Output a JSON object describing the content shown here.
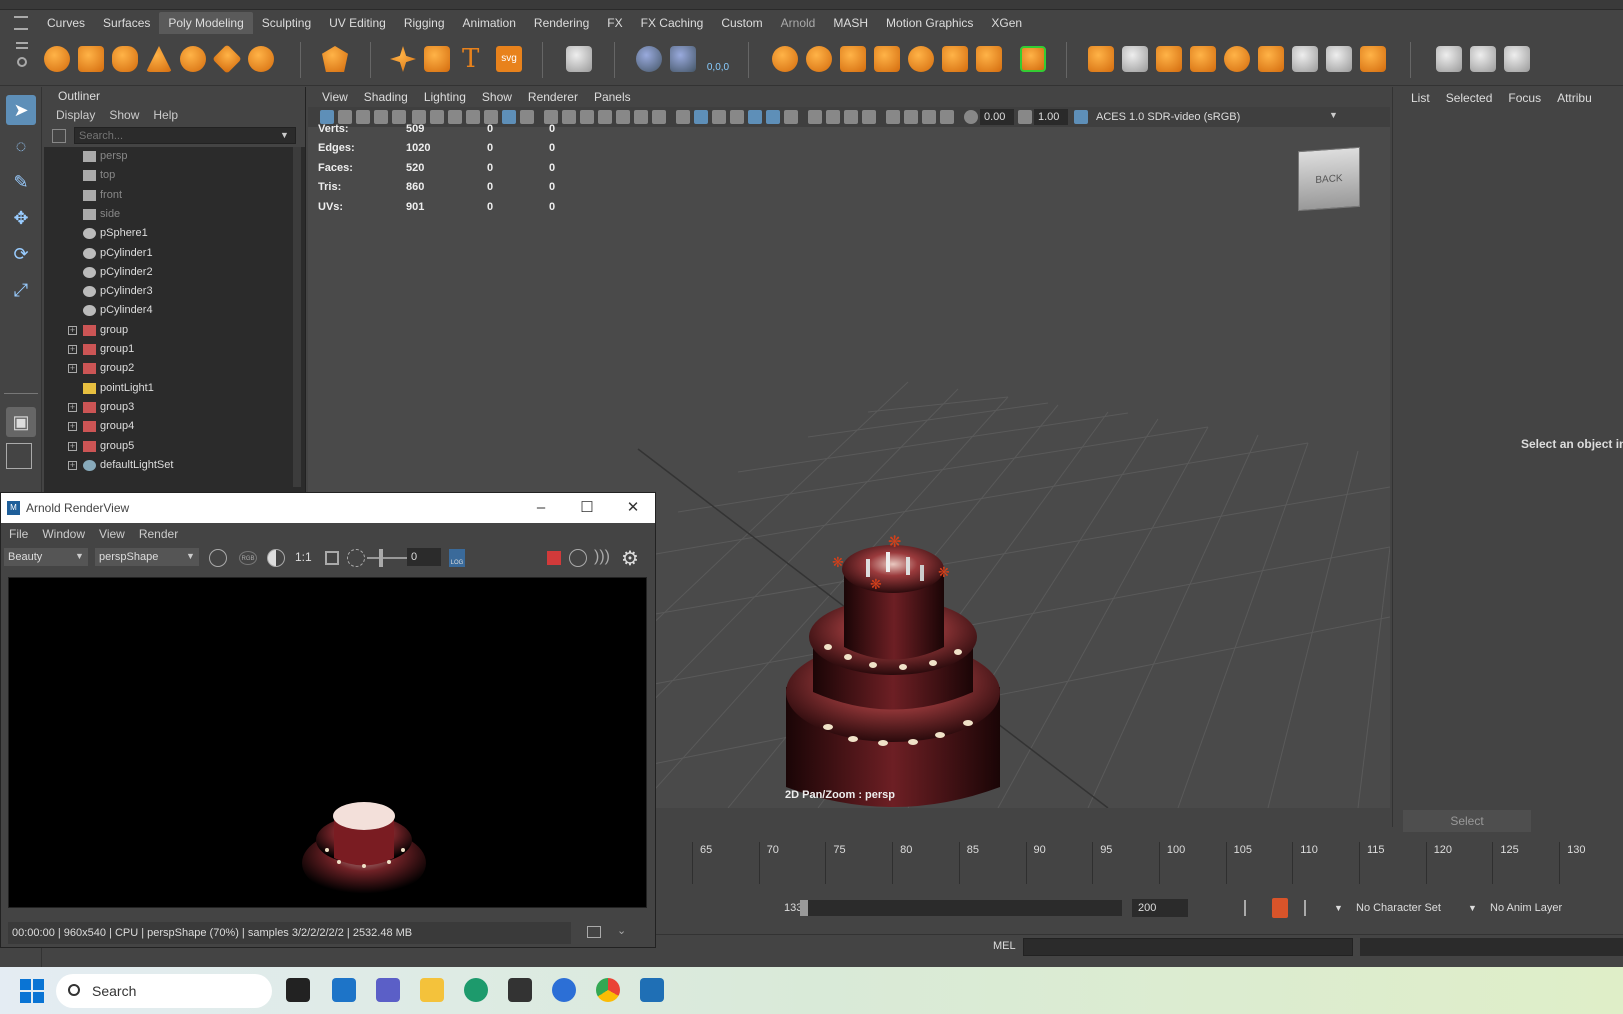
{
  "shelf": {
    "tabs": [
      "Curves",
      "Surfaces",
      "Poly Modeling",
      "Sculpting",
      "UV Editing",
      "Rigging",
      "Animation",
      "Rendering",
      "FX",
      "FX Caching",
      "Custom",
      "Arnold",
      "MASH",
      "Motion Graphics",
      "XGen"
    ],
    "active_tab": "Poly Modeling"
  },
  "outliner": {
    "title": "Outliner",
    "menu": [
      "Display",
      "Show",
      "Help"
    ],
    "search_placeholder": "Search...",
    "items": [
      {
        "label": "persp",
        "type": "camera",
        "dim": true
      },
      {
        "label": "top",
        "type": "camera",
        "dim": true
      },
      {
        "label": "front",
        "type": "camera",
        "dim": true
      },
      {
        "label": "side",
        "type": "camera",
        "dim": true
      },
      {
        "label": "pSphere1",
        "type": "mesh"
      },
      {
        "label": "pCylinder1",
        "type": "mesh"
      },
      {
        "label": "pCylinder2",
        "type": "mesh"
      },
      {
        "label": "pCylinder3",
        "type": "mesh"
      },
      {
        "label": "pCylinder4",
        "type": "mesh"
      },
      {
        "label": "group",
        "type": "group",
        "expandable": true
      },
      {
        "label": "group1",
        "type": "group",
        "expandable": true
      },
      {
        "label": "group2",
        "type": "group",
        "expandable": true
      },
      {
        "label": "pointLight1",
        "type": "light"
      },
      {
        "label": "group3",
        "type": "group",
        "expandable": true
      },
      {
        "label": "group4",
        "type": "group",
        "expandable": true
      },
      {
        "label": "group5",
        "type": "group",
        "expandable": true
      },
      {
        "label": "defaultLightSet",
        "type": "set",
        "expandable": true
      }
    ]
  },
  "viewport": {
    "menu": [
      "View",
      "Shading",
      "Lighting",
      "Show",
      "Renderer",
      "Panels"
    ],
    "exposure": "0.00",
    "gamma": "1.00",
    "color_space": "ACES 1.0 SDR-video (sRGB)",
    "hud": [
      {
        "label": "Verts:",
        "v1": "509",
        "v2": "0",
        "v3": "0"
      },
      {
        "label": "Edges:",
        "v1": "1020",
        "v2": "0",
        "v3": "0"
      },
      {
        "label": "Faces:",
        "v1": "520",
        "v2": "0",
        "v3": "0"
      },
      {
        "label": "Tris:",
        "v1": "860",
        "v2": "0",
        "v3": "0"
      },
      {
        "label": "UVs:",
        "v1": "901",
        "v2": "0",
        "v3": "0"
      }
    ],
    "viewcube_label": "BACK",
    "caption": "2D Pan/Zoom : persp"
  },
  "right_panel": {
    "tabs": [
      "List",
      "Selected",
      "Focus",
      "Attribu"
    ],
    "message": "Select an object in t",
    "select_button": "Select"
  },
  "timeline": {
    "ticks": [
      "65",
      "70",
      "75",
      "80",
      "85",
      "90",
      "95",
      "100",
      "105",
      "110",
      "115",
      "120",
      "125",
      "130"
    ]
  },
  "range": {
    "current": "133",
    "end": "200",
    "character_set": "No Character Set",
    "anim_layer": "No Anim Layer"
  },
  "command": {
    "label": "MEL"
  },
  "arnold": {
    "title": "Arnold RenderView",
    "menu": [
      "File",
      "Window",
      "View",
      "Render"
    ],
    "aov": "Beauty",
    "camera": "perspShape",
    "zoom": "1:1",
    "frame": "0",
    "log_label": "LOG",
    "rgb_label": "RGB",
    "status": "00:00:00 | 960x540 | CPU | perspShape (70%) | samples 3/2/2/2/2/2 | 2532.48 MB"
  },
  "taskbar": {
    "search_label": "Search"
  },
  "colors": {
    "accent": "#5e8fb8",
    "orange_icon": "#e8821c",
    "cake_red": "#7a1c22"
  }
}
